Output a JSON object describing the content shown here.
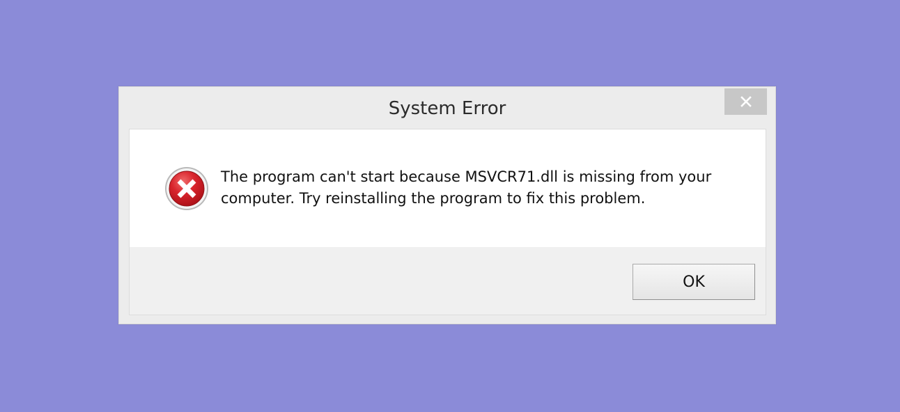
{
  "dialog": {
    "title": "System Error",
    "message": "The program can't start because MSVCR71.dll is missing from your computer. Try reinstalling the program to fix this problem.",
    "ok_label": "OK",
    "close_icon": "close-icon",
    "error_icon": "error-icon"
  },
  "colors": {
    "desktop_background": "#8b8bd8",
    "dialog_frame": "#ececec",
    "content_background": "#ffffff",
    "close_button": "#c7c7c7",
    "error_red": "#c8161d"
  }
}
